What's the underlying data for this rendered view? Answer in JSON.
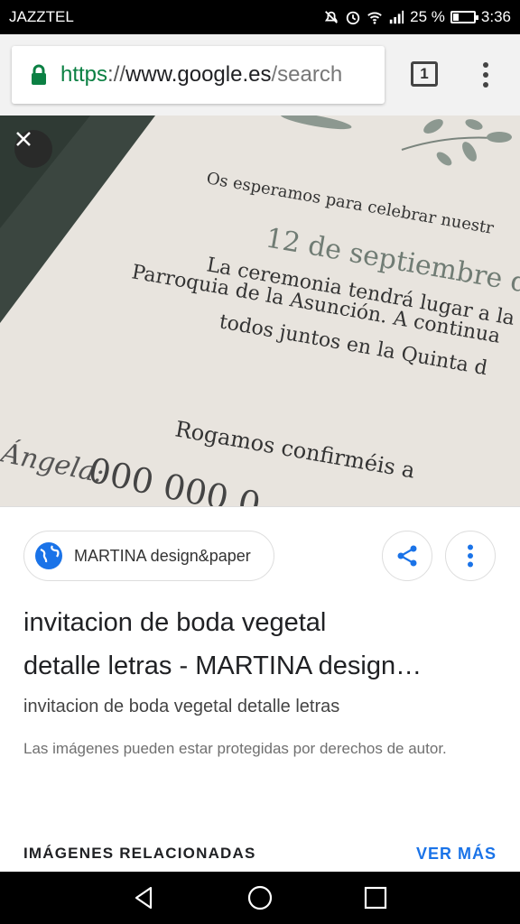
{
  "status_bar": {
    "carrier": "JAZZTEL",
    "battery": "25 %",
    "battery_level": 0.25,
    "time": "3:36",
    "icons": [
      "mute-icon",
      "alarm-icon",
      "wifi-icon",
      "signal-icon",
      "battery-icon"
    ]
  },
  "browser": {
    "url_scheme": "https",
    "url_separator": "://",
    "url_host": "www.google.es",
    "url_path": "/search",
    "tab_count": "1",
    "icons": [
      "lock-icon",
      "tabs-icon",
      "overflow-menu-icon"
    ]
  },
  "image": {
    "texts": {
      "line1": "Os esperamos para celebrar nuestr",
      "date": "12 de septiembre d",
      "line3": "La ceremonia tendrá lugar a la",
      "line4": "Parroquia de la Asunción. A continua",
      "line5": "todos juntos en la Quinta d",
      "rsvp": "Rogamos confirméis a",
      "name": "Ángela:",
      "phone": "000 000 0"
    },
    "close_icon": "close-icon"
  },
  "result": {
    "source": "MARTINA design&paper",
    "title_line1": "invitacion de boda vegetal",
    "title_line2": "detalle letras - MARTINA design…",
    "subtitle": "invitacion de boda vegetal detalle letras",
    "copyright": "Las imágenes pueden estar protegidas por derechos de autor.",
    "related_label": "IMÁGENES RELACIONADAS",
    "see_more": "VER MÁS",
    "colors": {
      "accent": "#1a73e8",
      "secure": "#0b8043"
    }
  },
  "nav": {
    "icons": [
      "back-icon",
      "home-icon",
      "recents-icon"
    ]
  }
}
